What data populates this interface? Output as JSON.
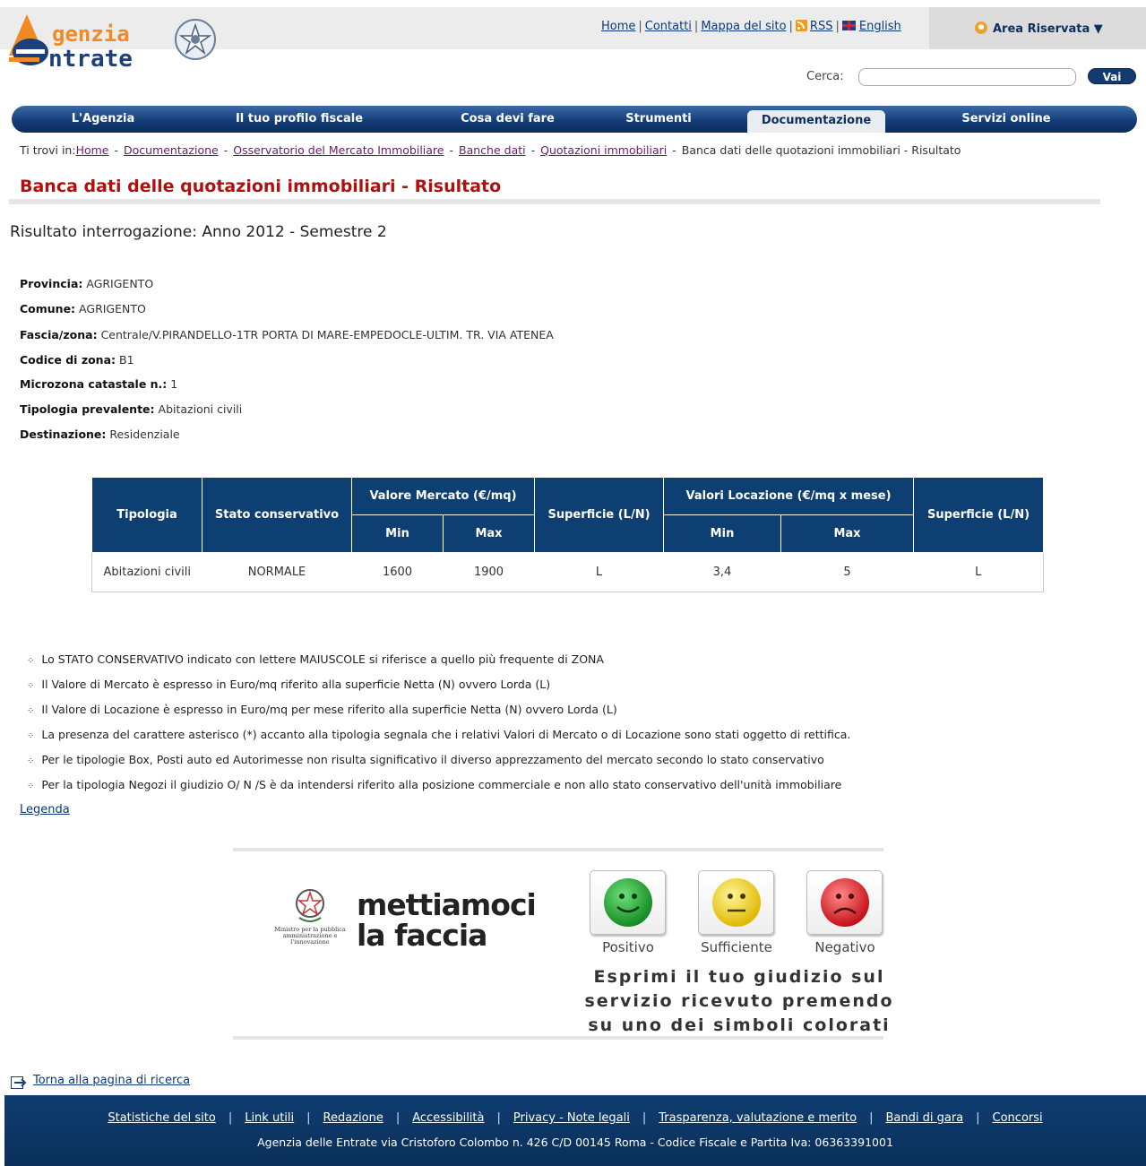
{
  "header": {
    "logo_line1": "genzia",
    "logo_line2": "ntrate",
    "links": [
      "Home",
      "Contatti",
      "Mappa del sito",
      "RSS",
      "English"
    ],
    "area_riservata": "Area Riservata ▼",
    "search_label": "Cerca:",
    "search_value": "",
    "search_button": "Vai"
  },
  "nav": {
    "items": [
      "L'Agenzia",
      "Il tuo profilo fiscale",
      "Cosa devi fare",
      "Strumenti",
      "Documentazione",
      "Servizi online"
    ],
    "active": "Documentazione"
  },
  "breadcrumb": {
    "prefix": "Ti trovi in:",
    "links": [
      "Home",
      "Documentazione",
      "Osservatorio del Mercato Immobiliare",
      "Banche dati",
      "Quotazioni immobiliari"
    ],
    "current": "Banca dati delle quotazioni immobiliari - Risultato"
  },
  "page_title": "Banca dati delle quotazioni immobiliari - Risultato",
  "result_heading": "Risultato interrogazione: Anno 2012 - Semestre 2",
  "fields": [
    {
      "label": "Provincia:",
      "value": "AGRIGENTO"
    },
    {
      "label": "Comune:",
      "value": "AGRIGENTO"
    },
    {
      "label": "Fascia/zona:",
      "value": "Centrale/V.PIRANDELLO-1TR PORTA DI MARE-EMPEDOCLE-ULTIM. TR. VIA ATENEA"
    },
    {
      "label": "Codice di zona:",
      "value": "B1"
    },
    {
      "label": "Microzona catastale n.:",
      "value": "1"
    },
    {
      "label": "Tipologia prevalente:",
      "value": "Abitazioni civili"
    },
    {
      "label": "Destinazione:",
      "value": "Residenziale"
    }
  ],
  "table": {
    "headers": {
      "tipologia": "Tipologia",
      "stato": "Stato conservativo",
      "valore_mercato": "Valore Mercato (€/mq)",
      "superficie1": "Superficie (L/N)",
      "valori_locazione": "Valori Locazione (€/mq x mese)",
      "superficie2": "Superficie (L/N)",
      "min": "Min",
      "max": "Max"
    },
    "rows": [
      {
        "tipologia": "Abitazioni civili",
        "stato": "NORMALE",
        "vm_min": "1600",
        "vm_max": "1900",
        "sup1": "L",
        "vl_min": "3,4",
        "vl_max": "5",
        "sup2": "L"
      }
    ]
  },
  "notes": [
    "Lo STATO CONSERVATIVO indicato con lettere MAIUSCOLE si riferisce a quello più frequente di ZONA",
    "Il Valore di Mercato è espresso in Euro/mq riferito alla superficie Netta (N) ovvero Lorda (L)",
    "Il Valore di Locazione è espresso in Euro/mq per mese riferito alla superficie Netta (N) ovvero Lorda (L)",
    "La presenza del carattere asterisco (*) accanto alla tipologia segnala che i relativi Valori di Mercato o di Locazione sono stati oggetto di rettifica.",
    "Per le tipologie Box, Posti auto ed Autorimesse non risulta significativo il diverso apprezzamento del mercato secondo lo stato conservativo",
    "Per la tipologia Negozi il giudizio O/ N /S è da intendersi riferito alla posizione commerciale e non allo stato conservativo dell'unità immobiliare"
  ],
  "legend_link": "Legenda",
  "feedback": {
    "ministry": "Ministro per la pubblica amministrazione e l'innovazione",
    "brand_line1": "mettiamoci",
    "brand_line2": "la faccia",
    "options": [
      "Positivo",
      "Sufficiente",
      "Negativo"
    ],
    "colors": {
      "positivo": "#1e9a2e",
      "sufficiente": "#f2d21a",
      "negativo": "#d8232a"
    },
    "prompt_line1": "Esprimi il tuo giudizio sul",
    "prompt_line2": "servizio ricevuto premendo",
    "prompt_line3": "su uno dei simboli colorati"
  },
  "back_link": "Torna alla pagina di ricerca",
  "footer": {
    "links": [
      "Statistiche del sito",
      "Link utili",
      "Redazione",
      "Accessibilità",
      "Privacy - Note legali",
      "Trasparenza, valutazione e merito",
      "Bandi di gara",
      "Concorsi"
    ],
    "address": "Agenzia delle Entrate via Cristoforo Colombo n. 426 C/D 00145 Roma - Codice Fiscale e Partita Iva: 06363391001"
  }
}
